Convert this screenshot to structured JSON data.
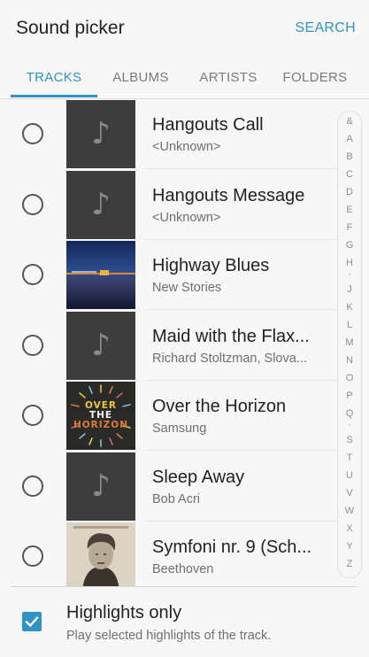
{
  "header": {
    "title": "Sound picker",
    "search_label": "SEARCH"
  },
  "tabs": [
    {
      "label": "TRACKS",
      "active": true
    },
    {
      "label": "ALBUMS",
      "active": false
    },
    {
      "label": "ARTISTS",
      "active": false
    },
    {
      "label": "FOLDERS",
      "active": false
    }
  ],
  "tracks": [
    {
      "title": "Hangouts Call",
      "subtitle": "<Unknown>",
      "art": "music-note-icon"
    },
    {
      "title": "Hangouts Message",
      "subtitle": "<Unknown>",
      "art": "music-note-icon"
    },
    {
      "title": "Highway Blues",
      "subtitle": "New Stories",
      "art": "album-art-highway-blues"
    },
    {
      "title": "Maid with the Flax...",
      "subtitle": "Richard Stoltzman, Slova...",
      "art": "music-note-icon"
    },
    {
      "title": "Over the Horizon",
      "subtitle": "Samsung",
      "art": "album-art-over-the-horizon"
    },
    {
      "title": "Sleep Away",
      "subtitle": "Bob Acri",
      "art": "music-note-icon"
    },
    {
      "title": "Symfoni nr. 9 (Sch...",
      "subtitle": "Beethoven",
      "art": "album-art-beethoven"
    }
  ],
  "album_art_text": {
    "over_the_horizon": [
      "OVER",
      "THE",
      "HORIZON"
    ]
  },
  "index_letters": [
    "&",
    "A",
    "B",
    "C",
    "D",
    "E",
    "F",
    "G",
    "H",
    "·",
    "J",
    "K",
    "L",
    "M",
    "N",
    "O",
    "P",
    "Q",
    "·",
    "S",
    "T",
    "U",
    "V",
    "W",
    "X",
    "Y",
    "Z"
  ],
  "highlights": {
    "label": "Highlights only",
    "description": "Play selected highlights of the track.",
    "checked": true
  },
  "colors": {
    "accent": "#2f93c7",
    "thumb_bg": "#3d3d3d"
  }
}
